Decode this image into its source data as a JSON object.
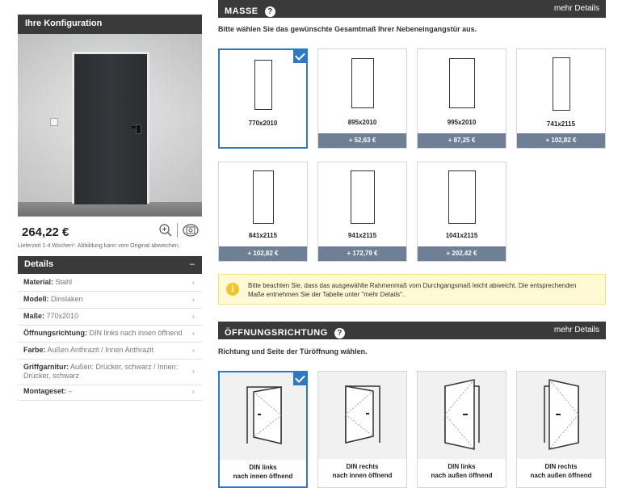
{
  "sidebar": {
    "config_title": "Ihre Konfiguration",
    "price": "264,22 €",
    "delivery_note": "Lieferzeit 1-4 Wochen¹. Abbildung kann vom Original abweichen.",
    "details_title": "Details",
    "details_toggle": "–",
    "details": [
      {
        "key": "Material:",
        "value": "Stahl"
      },
      {
        "key": "Modell:",
        "value": "Dinslaken"
      },
      {
        "key": "Maße:",
        "value": "770x2010"
      },
      {
        "key": "Öffnungsrichtung:",
        "value": "DIN links nach innen öffnend"
      },
      {
        "key": "Farbe:",
        "value": "Außen Anthrazit / Innen Anthrazit"
      },
      {
        "key": "Griffgarnitur:",
        "value": "Außen: Drücker, schwarz / Innen: Drücker, schwarz"
      },
      {
        "key": "Montageset:",
        "value": "–"
      }
    ]
  },
  "masse": {
    "title": "MASSE",
    "more": "mehr Details",
    "subtitle": "Bitte wählen Sie das gewünschte Gesamtmaß Ihrer Nebeneingangstür aus.",
    "options": [
      {
        "size": "770x2010",
        "price": "",
        "selected": true
      },
      {
        "size": "895x2010",
        "price": "+ 52,63 €",
        "selected": false
      },
      {
        "size": "995x2010",
        "price": "+ 87,25 €",
        "selected": false
      },
      {
        "size": "741x2115",
        "price": "+ 102,82 €",
        "selected": false
      },
      {
        "size": "841x2115",
        "price": "+ 102,82 €",
        "selected": false
      },
      {
        "size": "941x2115",
        "price": "+ 172,79 €",
        "selected": false
      },
      {
        "size": "1041x2115",
        "price": "+ 202,42 €",
        "selected": false
      }
    ],
    "info": "Bitte beachten Sie, dass das ausgewählte Rahmenmaß vom Durchgangsmaß leicht abweicht. Die entsprechenden Maße entnehmen Sie der Tabelle unter \"mehr Details\"."
  },
  "richtung": {
    "title": "ÖFFNUNGSRICHTUNG",
    "more": "mehr Details",
    "subtitle": "Richtung und Seite der Türöffnung wählen.",
    "options": [
      {
        "line1": "DIN links",
        "line2": "nach innen öffnend",
        "selected": true
      },
      {
        "line1": "DIN rechts",
        "line2": "nach innen öffnend",
        "selected": false
      },
      {
        "line1": "DIN links",
        "line2": "nach außen öffnend",
        "selected": false
      },
      {
        "line1": "DIN rechts",
        "line2": "nach außen öffnend",
        "selected": false
      }
    ]
  },
  "icons": [
    "zoom-in-icon",
    "rotate-360-icon",
    "help-icon",
    "checkmark-icon",
    "info-icon",
    "chevron-right-icon"
  ],
  "colors": {
    "header": "#3a3a3a",
    "accent": "#2f78c2",
    "price_bar": "#6f7f95",
    "info_bg": "#fff9d4"
  }
}
